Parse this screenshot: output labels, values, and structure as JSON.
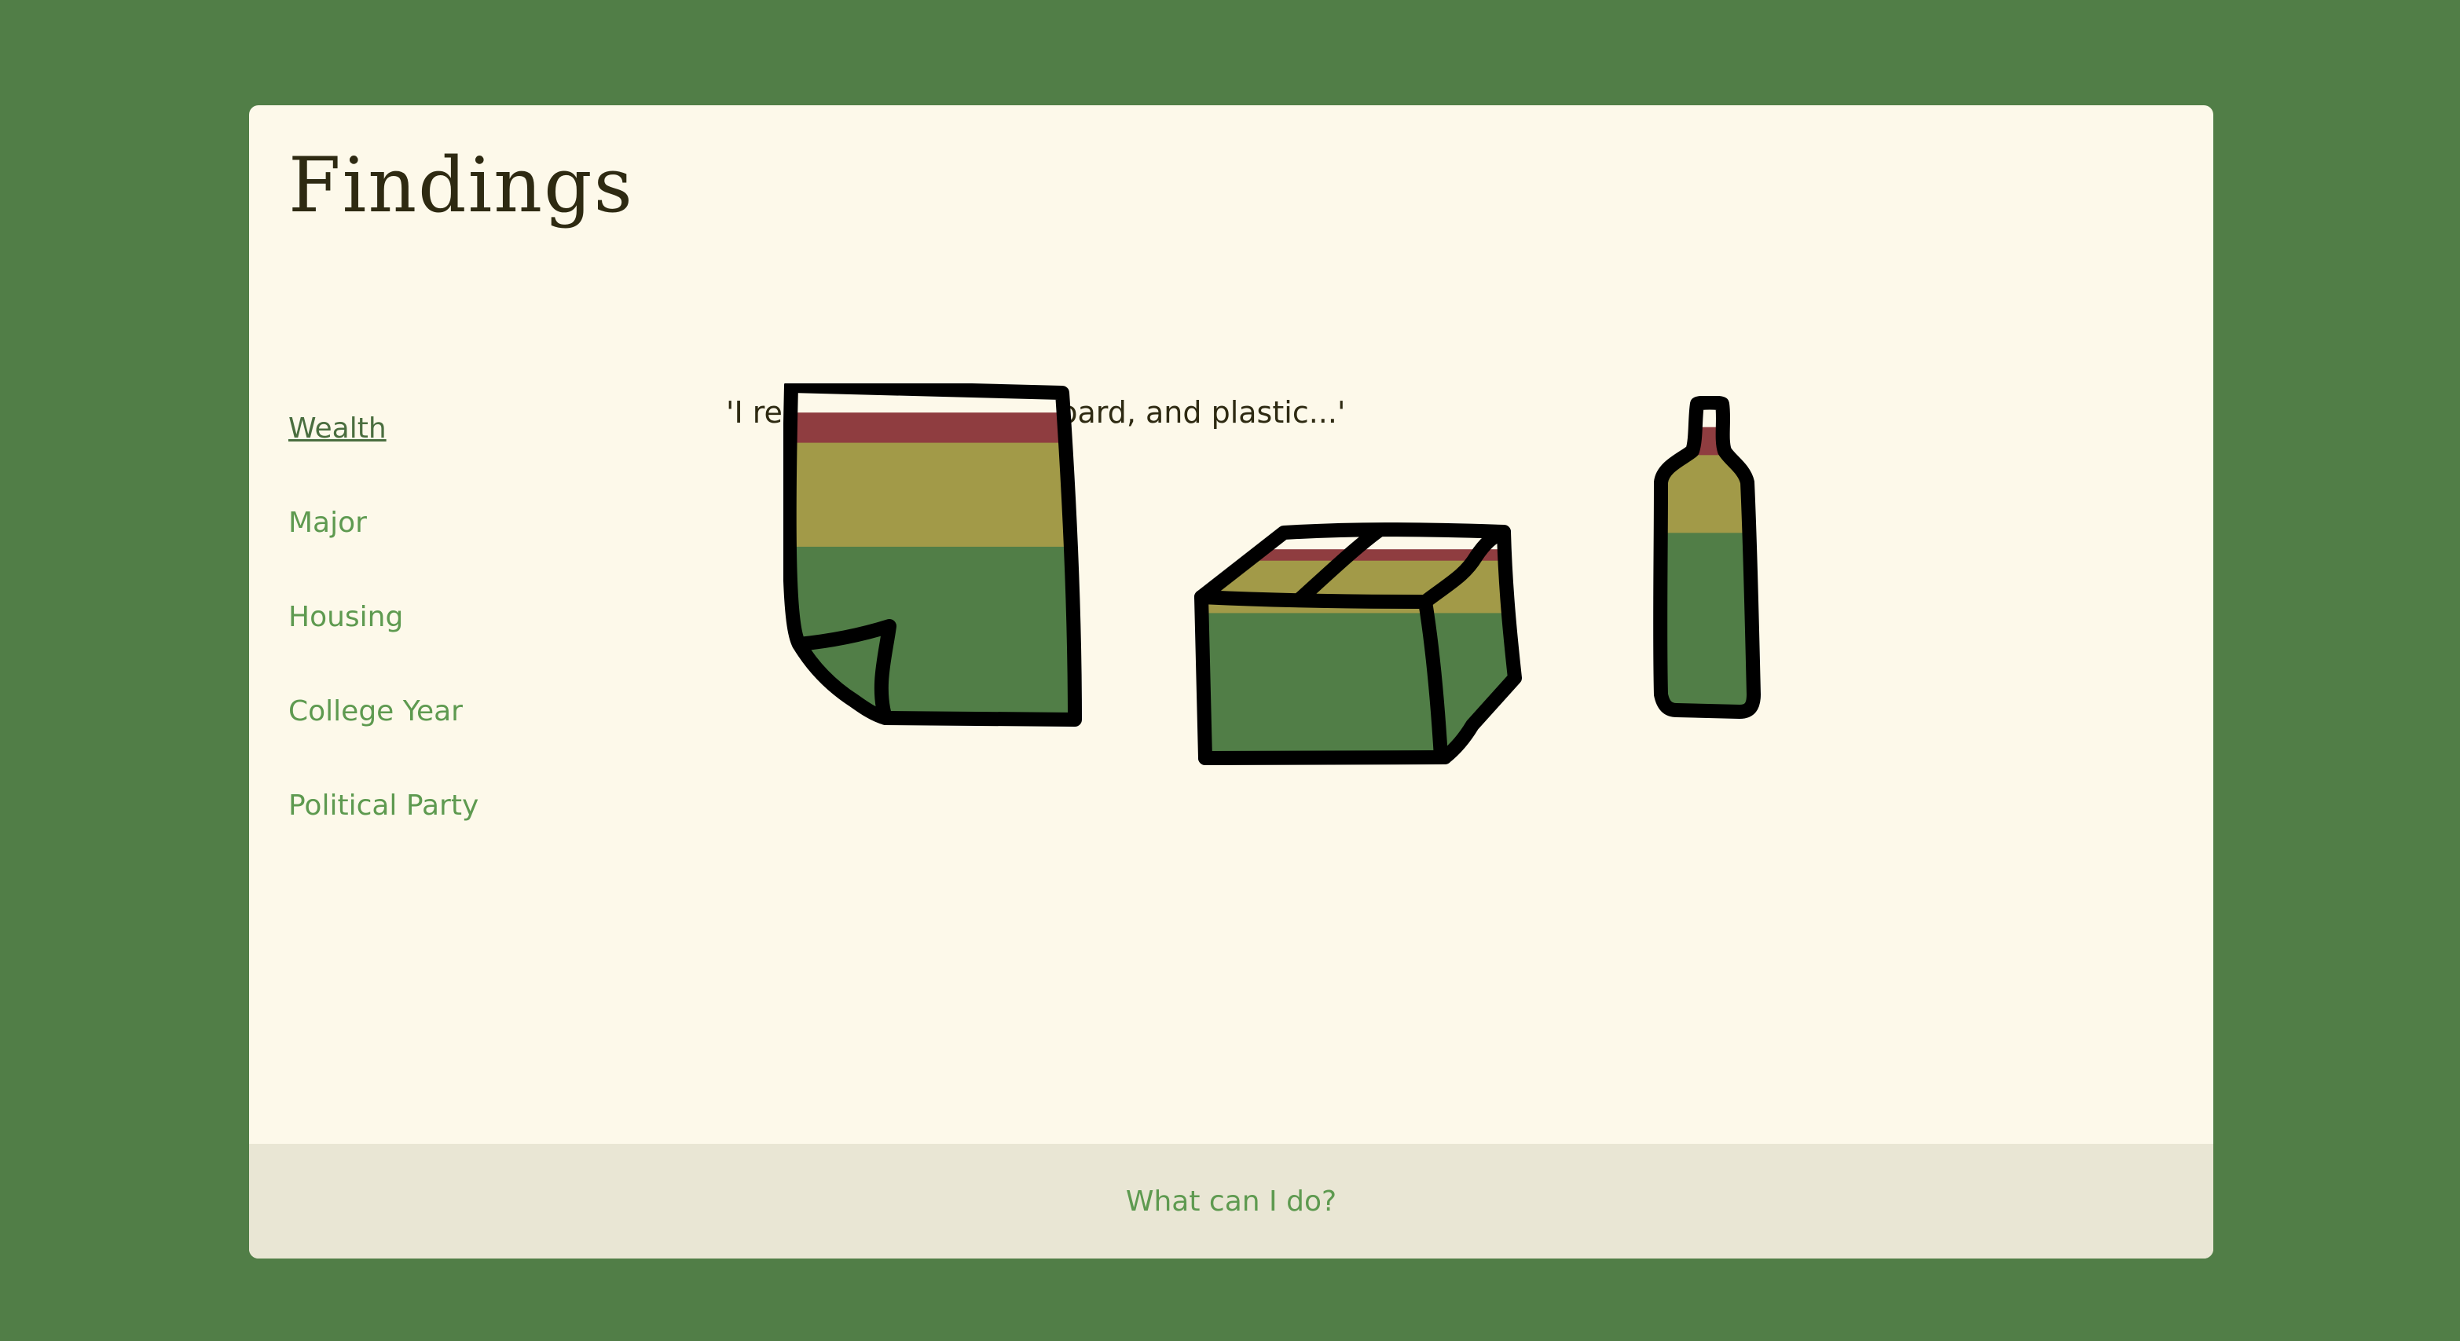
{
  "page": {
    "title": "Findings"
  },
  "sidebar": {
    "items": [
      {
        "label": "Wealth",
        "active": true
      },
      {
        "label": "Major",
        "active": false
      },
      {
        "label": "Housing",
        "active": false
      },
      {
        "label": "College Year",
        "active": false
      },
      {
        "label": "Political Party",
        "active": false
      }
    ]
  },
  "main": {
    "quote": "'I recycle paper, cardboard, and plastic...'",
    "items": [
      {
        "name": "paper",
        "fills": {
          "white": 0.08,
          "red": 0.09,
          "olive": 0.31,
          "green": 0.52
        }
      },
      {
        "name": "cardboard",
        "fills": {
          "white": 0.08,
          "red": 0.05,
          "olive": 0.23,
          "green": 0.64
        }
      },
      {
        "name": "plastic",
        "fills": {
          "white": 0.08,
          "red": 0.09,
          "olive": 0.25,
          "green": 0.58
        }
      }
    ]
  },
  "footer": {
    "link_label": "What can I do?"
  },
  "colors": {
    "background": "#517e47",
    "card": "#fdf9ea",
    "footer": "#e9e6d4",
    "white_fill": "#fdf9ea",
    "red_fill": "#8f3d40",
    "olive_fill": "#a29a48",
    "green_fill": "#517e47",
    "link": "#5e9a50",
    "text": "#2e2a12"
  }
}
